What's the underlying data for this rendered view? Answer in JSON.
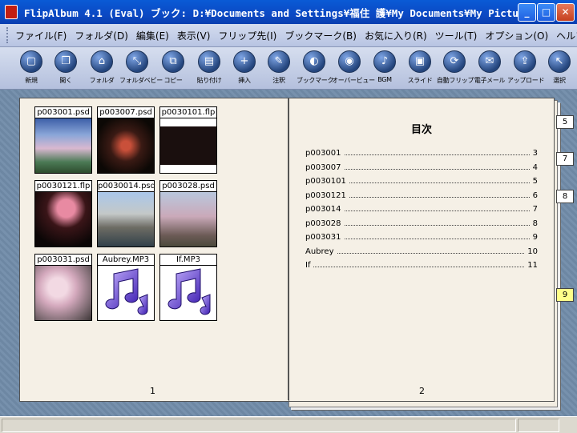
{
  "window": {
    "title": "FlipAlbum 4.1 (Eval)   ブック: D:¥Documents and Settings¥福住 護¥My Documents¥My Pictur..."
  },
  "menu": [
    "ファイル(F)",
    "フォルダ(D)",
    "編集(E)",
    "表示(V)",
    "フリップ先(I)",
    "ブックマーク(B)",
    "お気に入り(R)",
    "ツール(T)",
    "オプション(O)",
    "ヘルプ(H)"
  ],
  "toolbar": [
    {
      "label": "新規",
      "icon": "new-book-icon",
      "glyph": "▢"
    },
    {
      "label": "開く",
      "icon": "open-book-icon",
      "glyph": "❐"
    },
    {
      "label": "フォルダ",
      "icon": "folder-icon",
      "glyph": "⌂"
    },
    {
      "label": "フォルダベビー",
      "icon": "folder-view-icon",
      "glyph": "⤡"
    },
    {
      "label": "コピー",
      "icon": "copy-icon",
      "glyph": "⧉"
    },
    {
      "label": "貼り付け",
      "icon": "paste-icon",
      "glyph": "▤"
    },
    {
      "label": "挿入",
      "icon": "insert-icon",
      "glyph": "+"
    },
    {
      "label": "注釈",
      "icon": "annotate-icon",
      "glyph": "✎"
    },
    {
      "label": "ブックマーク",
      "icon": "bookmark-icon",
      "glyph": "◐"
    },
    {
      "label": "オーバービュー",
      "icon": "overview-icon",
      "glyph": "◉"
    },
    {
      "label": "BGM",
      "icon": "music-note-icon",
      "glyph": "♪"
    },
    {
      "label": "スライド",
      "icon": "slideshow-icon",
      "glyph": "▣"
    },
    {
      "label": "自動フリップ",
      "icon": "auto-flip-icon",
      "glyph": "⟳"
    },
    {
      "label": "電子メール",
      "icon": "email-icon",
      "glyph": "✉"
    },
    {
      "label": "アップロード",
      "icon": "upload-icon",
      "glyph": "⇪"
    },
    {
      "label": "選択",
      "icon": "select-arrow-icon",
      "glyph": "↖"
    }
  ],
  "left_page": {
    "number": "1",
    "thumbnails": [
      {
        "label": "p003001.psd",
        "kind": "photo-trees"
      },
      {
        "label": "p003007.psd",
        "kind": "photo-dark"
      },
      {
        "label": "p0030101.flp",
        "kind": "photo-album"
      },
      {
        "label": "p0030121.flp",
        "kind": "photo-lantern"
      },
      {
        "label": "p0030014.psd",
        "kind": "photo-canal"
      },
      {
        "label": "p003028.psd",
        "kind": "photo-blossom"
      },
      {
        "label": "p003031.psd",
        "kind": "photo-flowers"
      },
      {
        "label": "Aubrey.MP3",
        "kind": "music"
      },
      {
        "label": "If.MP3",
        "kind": "music"
      }
    ]
  },
  "right_page": {
    "number": "2",
    "title": "目次",
    "entries": [
      {
        "name": "p003001",
        "page": "3"
      },
      {
        "name": "p003007",
        "page": "4"
      },
      {
        "name": "p0030101",
        "page": "5"
      },
      {
        "name": "p0030121",
        "page": "6"
      },
      {
        "name": "p003014",
        "page": "7"
      },
      {
        "name": "p003028",
        "page": "8"
      },
      {
        "name": "p003031",
        "page": "9"
      },
      {
        "name": "Aubrey",
        "page": "10"
      },
      {
        "name": "If",
        "page": "11"
      }
    ]
  },
  "tabs": [
    {
      "label": "5",
      "active": false
    },
    {
      "label": "7",
      "active": false
    },
    {
      "label": "8",
      "active": false
    },
    {
      "label": "9",
      "active": true
    }
  ],
  "colors": {
    "title_bar": "#0b49c4",
    "page": "#f5f0e6",
    "active_tab": "#ffff8a"
  }
}
